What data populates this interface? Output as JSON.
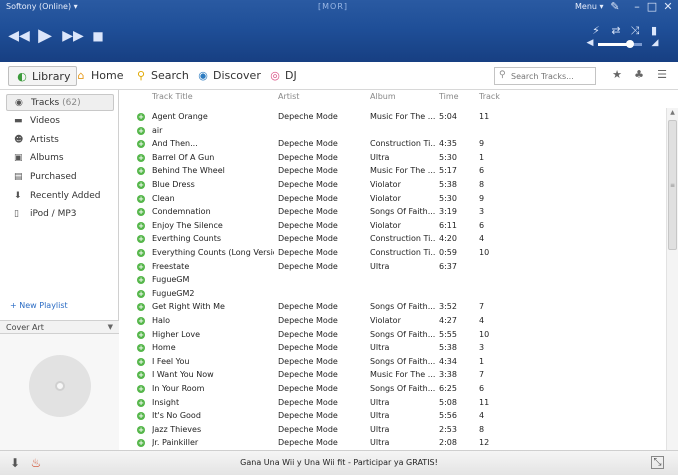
{
  "window": {
    "title": "Softony (Online)",
    "title_arrow": "▾",
    "logo": "[MOR]",
    "menu_label": "Menu ▾"
  },
  "player": {
    "volume_level": 0.65,
    "icons": {
      "prev": "previous-icon",
      "play": "play-icon",
      "next": "next-icon",
      "stop": "stop-icon"
    }
  },
  "nav": {
    "library": "Library",
    "home": "Home",
    "search": "Search",
    "discover": "Discover",
    "dj": "DJ",
    "search_placeholder": "Search Tracks..."
  },
  "sidebar": {
    "items": [
      {
        "label": "Tracks",
        "count": "(62)"
      },
      {
        "label": "Videos"
      },
      {
        "label": "Artists"
      },
      {
        "label": "Albums"
      },
      {
        "label": "Purchased"
      },
      {
        "label": "Recently Added"
      },
      {
        "label": "iPod / MP3"
      }
    ],
    "new_playlist": "+ New Playlist",
    "cover_art_label": "Cover Art"
  },
  "table": {
    "headers": {
      "title": "Track Title",
      "artist": "Artist",
      "album": "Album",
      "time": "Time",
      "track": "Track"
    },
    "rows": [
      {
        "title": "Agent Orange",
        "artist": "Depeche Mode",
        "album": "Music For The ...",
        "time": "5:04",
        "track": "11"
      },
      {
        "title": "air",
        "artist": "",
        "album": "",
        "time": "",
        "track": ""
      },
      {
        "title": "And Then...",
        "artist": "Depeche Mode",
        "album": "Construction Ti...",
        "time": "4:35",
        "track": "9"
      },
      {
        "title": "Barrel Of A Gun",
        "artist": "Depeche Mode",
        "album": "Ultra",
        "time": "5:30",
        "track": "1"
      },
      {
        "title": "Behind The Wheel",
        "artist": "Depeche Mode",
        "album": "Music For The ...",
        "time": "5:17",
        "track": "6"
      },
      {
        "title": "Blue Dress",
        "artist": "Depeche Mode",
        "album": "Violator",
        "time": "5:38",
        "track": "8"
      },
      {
        "title": "Clean",
        "artist": "Depeche Mode",
        "album": "Violator",
        "time": "5:30",
        "track": "9"
      },
      {
        "title": "Condemnation",
        "artist": "Depeche Mode",
        "album": "Songs Of Faith...",
        "time": "3:19",
        "track": "3"
      },
      {
        "title": "Enjoy The Silence",
        "artist": "Depeche Mode",
        "album": "Violator",
        "time": "6:11",
        "track": "6"
      },
      {
        "title": "Everthing Counts",
        "artist": "Depeche Mode",
        "album": "Construction Ti...",
        "time": "4:20",
        "track": "4"
      },
      {
        "title": "Everything Counts (Long Version)",
        "artist": "Depeche Mode",
        "album": "Construction Ti...",
        "time": "0:59",
        "track": "10"
      },
      {
        "title": "Freestate",
        "artist": "Depeche Mode",
        "album": "Ultra",
        "time": "6:37",
        "track": ""
      },
      {
        "title": "FugueGM",
        "artist": "",
        "album": "",
        "time": "",
        "track": ""
      },
      {
        "title": "FugueGM2",
        "artist": "",
        "album": "",
        "time": "",
        "track": ""
      },
      {
        "title": "Get Right With Me",
        "artist": "Depeche Mode",
        "album": "Songs Of Faith...",
        "time": "3:52",
        "track": "7"
      },
      {
        "title": "Halo",
        "artist": "Depeche Mode",
        "album": "Violator",
        "time": "4:27",
        "track": "4"
      },
      {
        "title": "Higher Love",
        "artist": "Depeche Mode",
        "album": "Songs Of Faith...",
        "time": "5:55",
        "track": "10"
      },
      {
        "title": "Home",
        "artist": "Depeche Mode",
        "album": "Ultra",
        "time": "5:38",
        "track": "3"
      },
      {
        "title": "I Feel You",
        "artist": "Depeche Mode",
        "album": "Songs Of Faith...",
        "time": "4:34",
        "track": "1"
      },
      {
        "title": "I Want You Now",
        "artist": "Depeche Mode",
        "album": "Music For The ...",
        "time": "3:38",
        "track": "7"
      },
      {
        "title": "In Your Room",
        "artist": "Depeche Mode",
        "album": "Songs Of Faith...",
        "time": "6:25",
        "track": "6"
      },
      {
        "title": "Insight",
        "artist": "Depeche Mode",
        "album": "Ultra",
        "time": "5:08",
        "track": "11"
      },
      {
        "title": "It's No Good",
        "artist": "Depeche Mode",
        "album": "Ultra",
        "time": "5:56",
        "track": "4"
      },
      {
        "title": "Jazz Thieves",
        "artist": "Depeche Mode",
        "album": "Ultra",
        "time": "2:53",
        "track": "8"
      },
      {
        "title": "Jr. Painkiller",
        "artist": "Depeche Mode",
        "album": "Ultra",
        "time": "2:08",
        "track": "12"
      }
    ]
  },
  "bottom": {
    "ad_text": "Gana Una Wii y Una Wii fit - Participar ya GRATIS!"
  }
}
